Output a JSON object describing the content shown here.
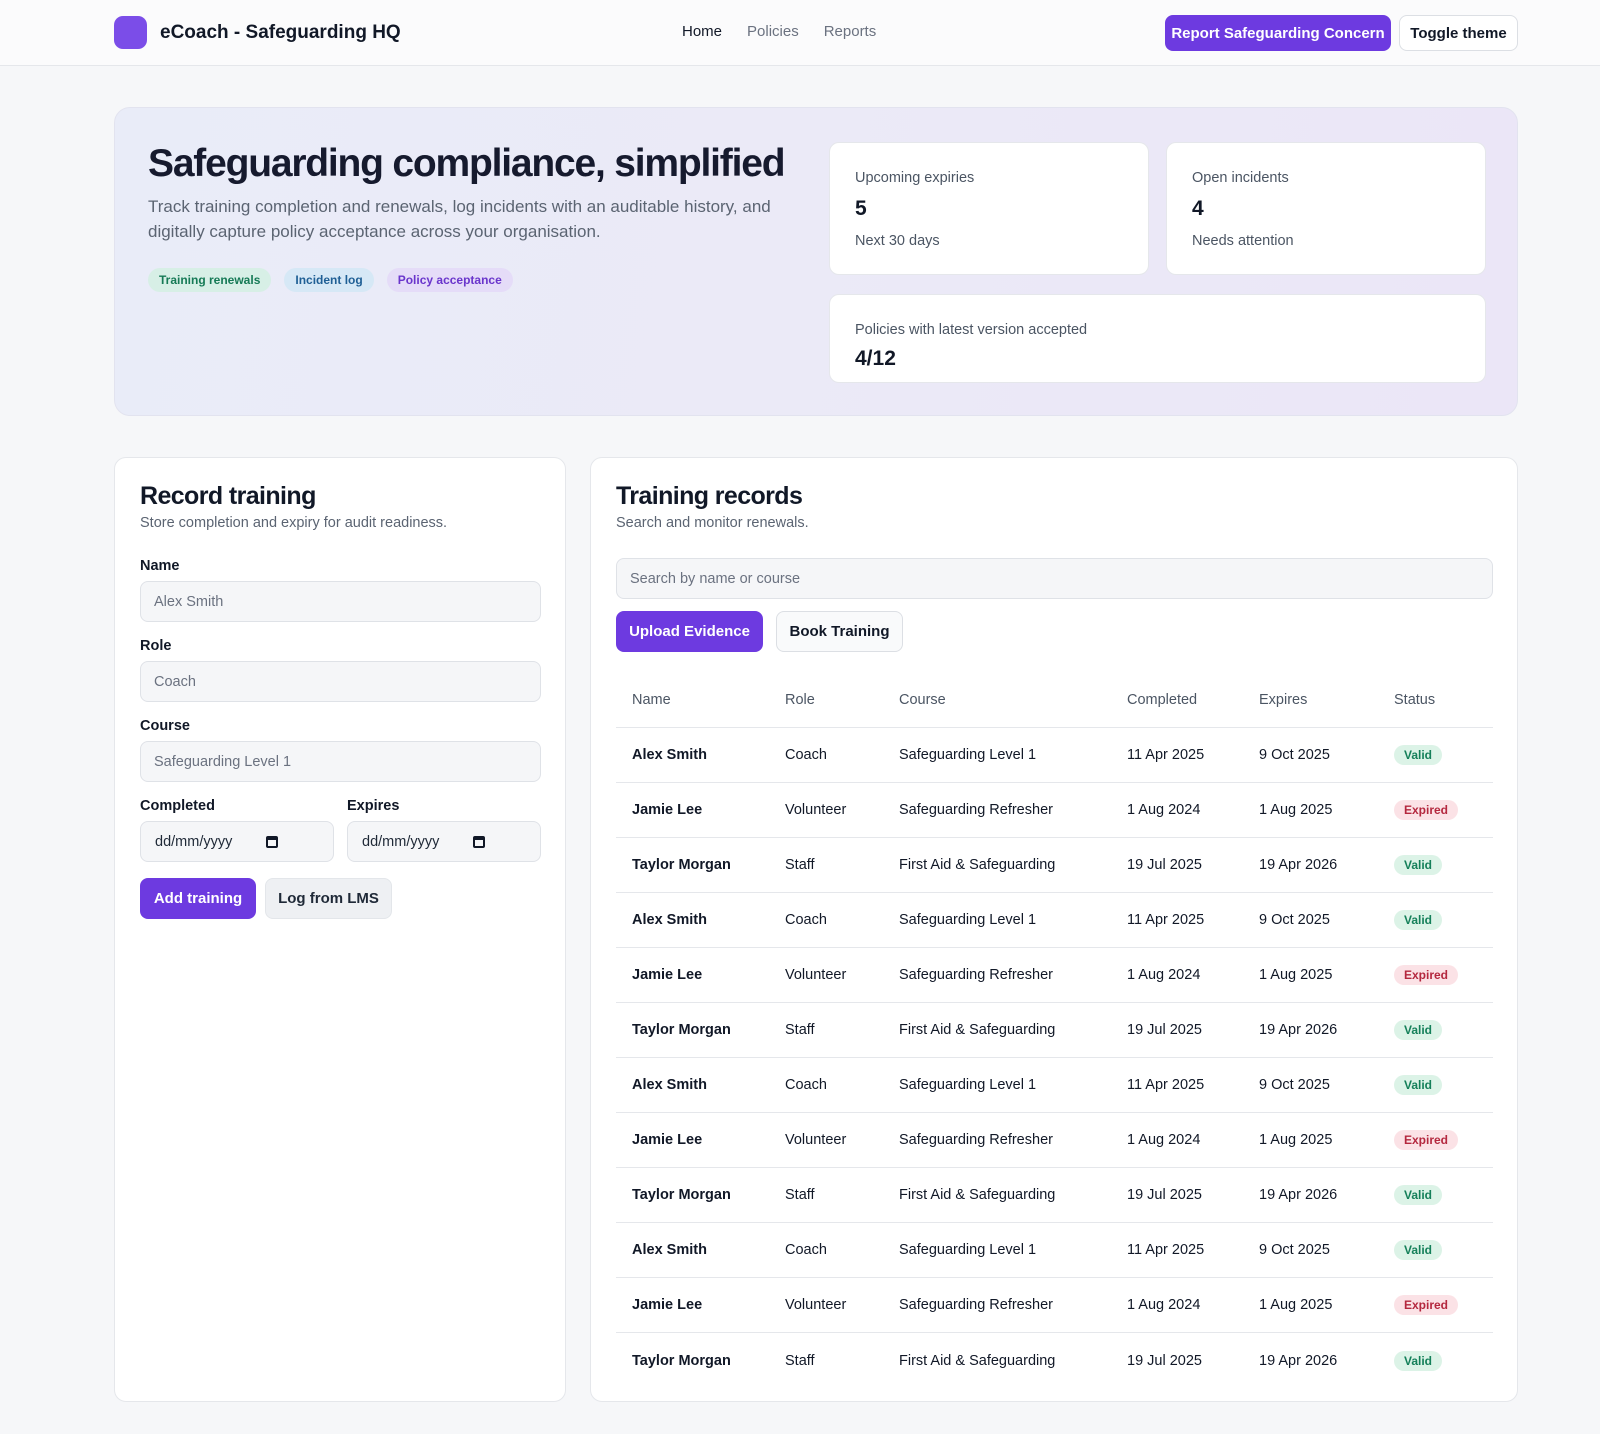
{
  "header": {
    "app_title": "eCoach - Safeguarding HQ",
    "nav": [
      {
        "label": "Home",
        "active": true
      },
      {
        "label": "Policies",
        "active": false
      },
      {
        "label": "Reports",
        "active": false
      }
    ],
    "report_button": "Report Safeguarding Concern",
    "theme_button": "Toggle theme"
  },
  "hero": {
    "title": "Safeguarding compliance, simplified",
    "subtitle": "Track training completion and renewals, log incidents with an auditable history, and digitally capture policy acceptance across your organisation.",
    "tags": [
      "Training renewals",
      "Incident log",
      "Policy acceptance"
    ],
    "stats": {
      "upcoming": {
        "label": "Upcoming expiries",
        "value": "5",
        "hint": "Next 30 days"
      },
      "incidents": {
        "label": "Open incidents",
        "value": "4",
        "hint": "Needs attention"
      },
      "policies": {
        "label": "Policies with latest version accepted",
        "value": "4/12"
      }
    }
  },
  "record_training": {
    "title": "Record training",
    "subtitle": "Store completion and expiry for audit readiness.",
    "name": {
      "label": "Name",
      "placeholder": "Alex Smith"
    },
    "role": {
      "label": "Role",
      "placeholder": "Coach"
    },
    "course": {
      "label": "Course",
      "placeholder": "Safeguarding Level 1"
    },
    "completed": {
      "label": "Completed",
      "value": "dd/mm/yyyy"
    },
    "expires": {
      "label": "Expires",
      "value": "dd/mm/yyyy"
    },
    "add_button": "Add training",
    "lms_button": "Log from LMS"
  },
  "training_records": {
    "title": "Training records",
    "subtitle": "Search and monitor renewals.",
    "search_placeholder": "Search by name or course",
    "upload_button": "Upload Evidence",
    "book_button": "Book Training",
    "columns": [
      "Name",
      "Role",
      "Course",
      "Completed",
      "Expires",
      "Status"
    ],
    "rows": [
      {
        "name": "Alex Smith",
        "role": "Coach",
        "course": "Safeguarding Level 1",
        "completed": "11 Apr 2025",
        "expires": "9 Oct 2025",
        "status": "Valid"
      },
      {
        "name": "Jamie Lee",
        "role": "Volunteer",
        "course": "Safeguarding Refresher",
        "completed": "1 Aug 2024",
        "expires": "1 Aug 2025",
        "status": "Expired"
      },
      {
        "name": "Taylor Morgan",
        "role": "Staff",
        "course": "First Aid & Safeguarding",
        "completed": "19 Jul 2025",
        "expires": "19 Apr 2026",
        "status": "Valid"
      },
      {
        "name": "Alex Smith",
        "role": "Coach",
        "course": "Safeguarding Level 1",
        "completed": "11 Apr 2025",
        "expires": "9 Oct 2025",
        "status": "Valid"
      },
      {
        "name": "Jamie Lee",
        "role": "Volunteer",
        "course": "Safeguarding Refresher",
        "completed": "1 Aug 2024",
        "expires": "1 Aug 2025",
        "status": "Expired"
      },
      {
        "name": "Taylor Morgan",
        "role": "Staff",
        "course": "First Aid & Safeguarding",
        "completed": "19 Jul 2025",
        "expires": "19 Apr 2026",
        "status": "Valid"
      },
      {
        "name": "Alex Smith",
        "role": "Coach",
        "course": "Safeguarding Level 1",
        "completed": "11 Apr 2025",
        "expires": "9 Oct 2025",
        "status": "Valid"
      },
      {
        "name": "Jamie Lee",
        "role": "Volunteer",
        "course": "Safeguarding Refresher",
        "completed": "1 Aug 2024",
        "expires": "1 Aug 2025",
        "status": "Expired"
      },
      {
        "name": "Taylor Morgan",
        "role": "Staff",
        "course": "First Aid & Safeguarding",
        "completed": "19 Jul 2025",
        "expires": "19 Apr 2026",
        "status": "Valid"
      },
      {
        "name": "Alex Smith",
        "role": "Coach",
        "course": "Safeguarding Level 1",
        "completed": "11 Apr 2025",
        "expires": "9 Oct 2025",
        "status": "Valid"
      },
      {
        "name": "Jamie Lee",
        "role": "Volunteer",
        "course": "Safeguarding Refresher",
        "completed": "1 Aug 2024",
        "expires": "1 Aug 2025",
        "status": "Expired"
      },
      {
        "name": "Taylor Morgan",
        "role": "Staff",
        "course": "First Aid & Safeguarding",
        "completed": "19 Jul 2025",
        "expires": "19 Apr 2026",
        "status": "Valid"
      }
    ]
  },
  "colors": {
    "accent": "#6d3ae0",
    "valid_bg": "#dcf3e7",
    "valid_text": "#15805a",
    "expired_bg": "#fbe2e6",
    "expired_text": "#b4283f"
  },
  "icons": {
    "brand": "brand-logo-icon",
    "date_picker": "calendar-icon"
  }
}
